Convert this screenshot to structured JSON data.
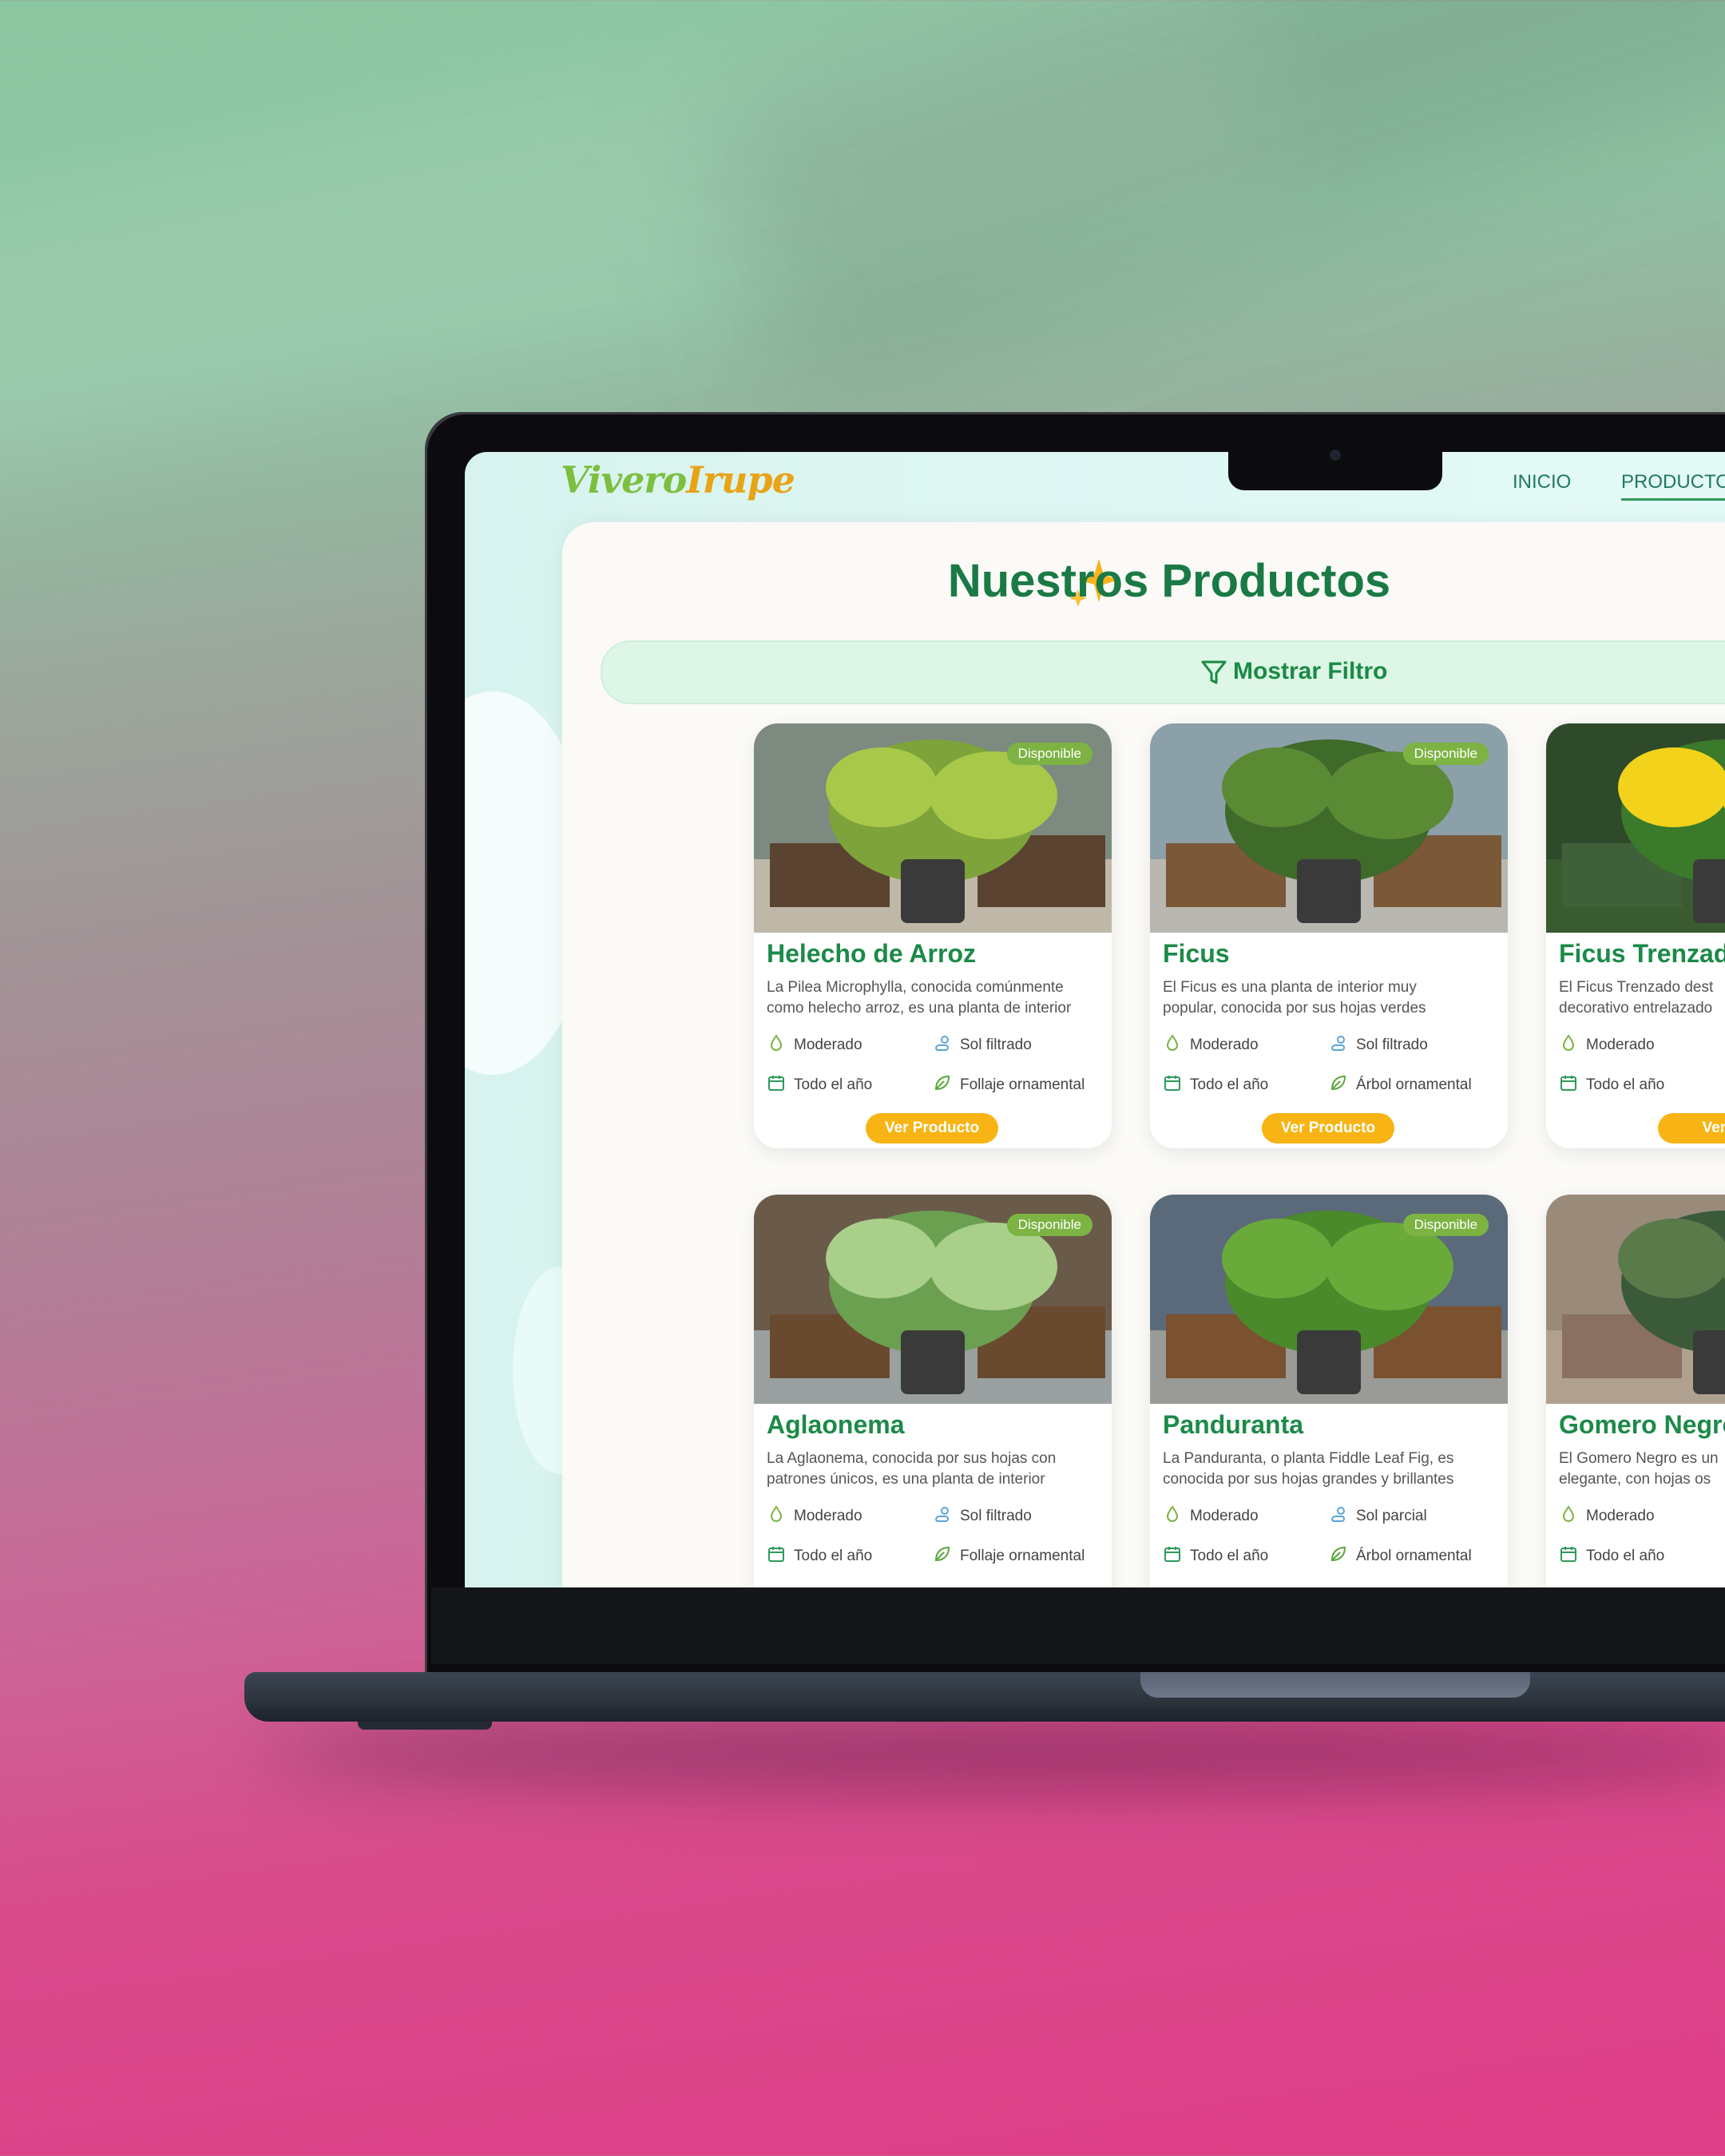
{
  "brand": {
    "name_part1": "Vivero",
    "name_part2": "Irupe"
  },
  "nav": {
    "links": [
      "INICIO",
      "PRODUCTOS"
    ],
    "active": "PRODUCTOS"
  },
  "page": {
    "title": "Nuestros Productos",
    "filter_label": "Mostrar Filtro"
  },
  "colors": {
    "accent_green": "#1a7a45",
    "button": "#f8b414",
    "badge": "#7cb342"
  },
  "products": [
    {
      "name": "Helecho de Arroz",
      "badge": "Disponible",
      "desc_line1": "La Pilea Microphylla, conocida comúnmente",
      "desc_line2": "como helecho arroz, es una planta de interior",
      "water": "Moderado",
      "light": "Sol filtrado",
      "season": "Todo el año",
      "type": "Follaje ornamental",
      "button": "Ver Producto"
    },
    {
      "name": "Ficus",
      "badge": "Disponible",
      "desc_line1": "El Ficus es una planta de interior muy",
      "desc_line2": "popular, conocida por sus hojas verdes",
      "water": "Moderado",
      "light": "Sol filtrado",
      "season": "Todo el año",
      "type": "Árbol ornamental",
      "button": "Ver Producto"
    },
    {
      "name": "Ficus Trenzado",
      "badge": "",
      "desc_line1": "El Ficus Trenzado dest",
      "desc_line2": "decorativo entrelazado",
      "water": "Moderado",
      "light": "",
      "season": "Todo el año",
      "type": "",
      "button": "Ver Pr"
    },
    {
      "name": "Aglaonema",
      "badge": "Disponible",
      "desc_line1": "La Aglaonema, conocida por sus hojas con",
      "desc_line2": "patrones únicos, es una planta de interior",
      "water": "Moderado",
      "light": "Sol filtrado",
      "season": "Todo el año",
      "type": "Follaje ornamental",
      "button": ""
    },
    {
      "name": "Panduranta",
      "badge": "Disponible",
      "desc_line1": "La Panduranta, o planta Fiddle Leaf Fig, es",
      "desc_line2": "conocida por sus hojas grandes y brillantes",
      "water": "Moderado",
      "light": "Sol parcial",
      "season": "Todo el año",
      "type": "Árbol ornamental",
      "button": ""
    },
    {
      "name": "Gomero Negro",
      "badge": "",
      "desc_line1": "El Gomero Negro es un",
      "desc_line2": "elegante, con hojas os",
      "water": "Moderado",
      "light": "",
      "season": "Todo el año",
      "type": "",
      "button": ""
    }
  ]
}
